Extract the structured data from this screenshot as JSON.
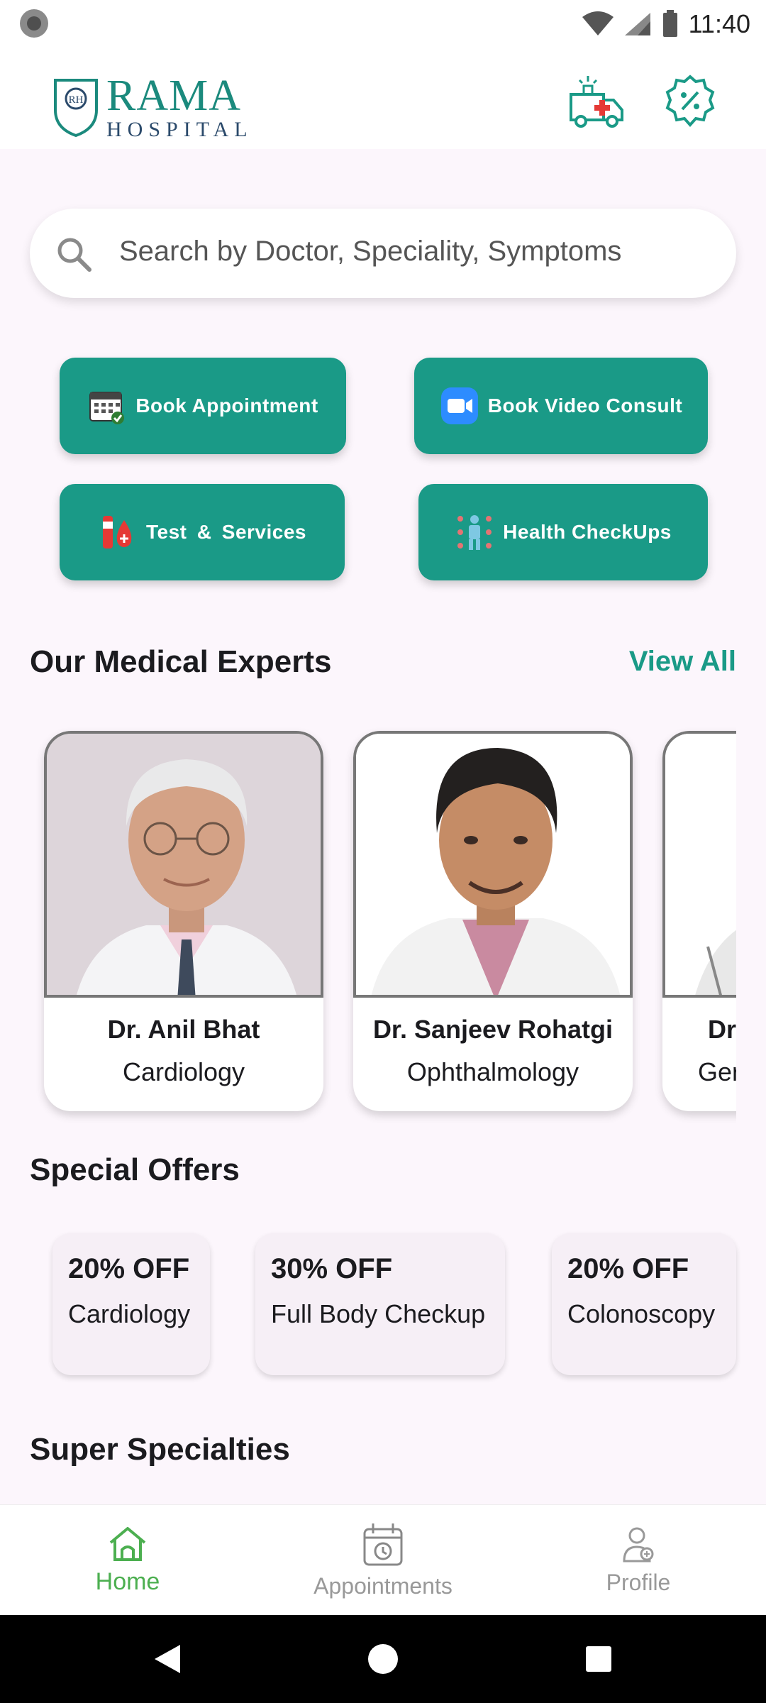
{
  "status_bar": {
    "time": "11:40"
  },
  "header": {
    "logo_title": "RAMA",
    "logo_subtitle": "HOSPITAL",
    "logo_mark": "RH"
  },
  "search": {
    "placeholder": "Search by Doctor, Speciality, Symptoms"
  },
  "actions": [
    {
      "label": "Book Appointment",
      "icon": "calendar-icon"
    },
    {
      "label": "Book Video Consult",
      "icon": "video-icon"
    },
    {
      "label": "Test & Services",
      "icon": "test-tube-icon"
    },
    {
      "label": "Health CheckUps",
      "icon": "body-scan-icon"
    }
  ],
  "experts": {
    "title": "Our Medical Experts",
    "view_all": "View All",
    "doctors": [
      {
        "name": "Dr. Anil Bhat",
        "speciality": "Cardiology"
      },
      {
        "name": "Dr. Sanjeev Rohatgi",
        "speciality": "Ophthalmology"
      },
      {
        "name": "Dr",
        "speciality": "Ger"
      }
    ]
  },
  "offers": {
    "title": "Special Offers",
    "items": [
      {
        "discount": "20% OFF",
        "label": "Cardiology"
      },
      {
        "discount": "30% OFF",
        "label": "Full Body Checkup"
      },
      {
        "discount": "20% OFF",
        "label": "Colonoscopy"
      }
    ]
  },
  "specialties": {
    "title": "Super Specialties"
  },
  "bottom_nav": {
    "items": [
      {
        "label": "Home",
        "icon": "home-icon",
        "active": true
      },
      {
        "label": "Appointments",
        "icon": "calendar-clock-icon",
        "active": false
      },
      {
        "label": "Profile",
        "icon": "doctor-profile-icon",
        "active": false
      }
    ]
  },
  "colors": {
    "primary": "#1a9a87",
    "active_nav": "#4caf50",
    "background": "#fcf6fc"
  }
}
